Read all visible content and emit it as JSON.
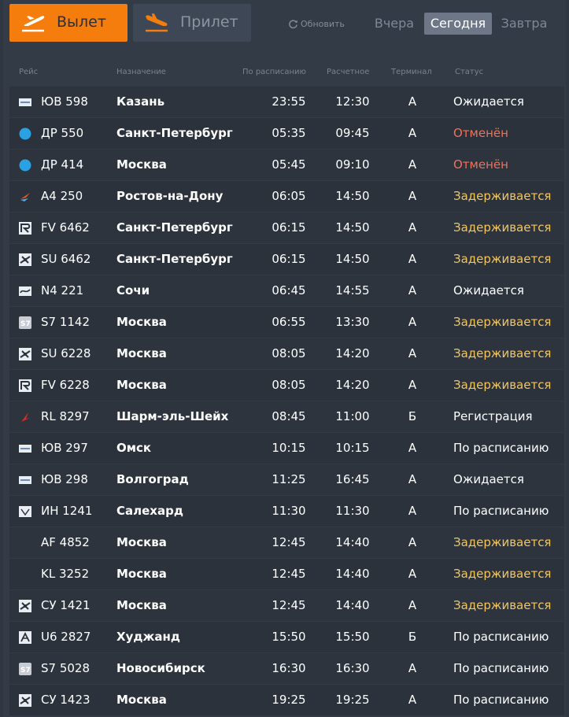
{
  "tabs": {
    "departures_label": "Вылет",
    "arrivals_label": "Прилет"
  },
  "refresh_label": "Обновить",
  "days": {
    "yesterday": "Вчера",
    "today": "Сегодня",
    "tomorrow": "Завтра",
    "selected": "today"
  },
  "columns": {
    "flight": "Рейс",
    "destination": "Назначение",
    "scheduled": "По расписанию",
    "estimated": "Расчетное",
    "terminal": "Терминал",
    "status": "Статус"
  },
  "colors": {
    "accent": "#f47d0d",
    "cancelled": "#f07158",
    "delayed": "#f5c65a"
  },
  "flights": [
    {
      "logo": "yuv-logo",
      "flight": "ЮВ 598",
      "destination": "Казань",
      "scheduled": "23:55",
      "estimated": "12:30",
      "terminal": "А",
      "status": "Ожидается",
      "state": "normal"
    },
    {
      "logo": "blue-dot-logo",
      "flight": "ДР 550",
      "destination": "Санкт-Петербург",
      "scheduled": "05:35",
      "estimated": "09:45",
      "terminal": "А",
      "status": "Отменён",
      "state": "cancelled"
    },
    {
      "logo": "blue-dot-logo",
      "flight": "ДР 414",
      "destination": "Москва",
      "scheduled": "05:45",
      "estimated": "09:10",
      "terminal": "А",
      "status": "Отменён",
      "state": "cancelled"
    },
    {
      "logo": "azimuth-logo",
      "flight": "А4 250",
      "destination": "Ростов-на-Дону",
      "scheduled": "06:05",
      "estimated": "14:50",
      "terminal": "А",
      "status": "Задерживается",
      "state": "delayed"
    },
    {
      "logo": "rossiya-logo",
      "flight": "FV 6462",
      "destination": "Санкт-Петербург",
      "scheduled": "06:15",
      "estimated": "14:50",
      "terminal": "А",
      "status": "Задерживается",
      "state": "delayed"
    },
    {
      "logo": "aeroflot-logo",
      "flight": "SU 6462",
      "destination": "Санкт-Петербург",
      "scheduled": "06:15",
      "estimated": "14:50",
      "terminal": "А",
      "status": "Задерживается",
      "state": "delayed"
    },
    {
      "logo": "nordwind-logo",
      "flight": "N4 221",
      "destination": "Сочи",
      "scheduled": "06:45",
      "estimated": "14:55",
      "terminal": "А",
      "status": "Ожидается",
      "state": "normal"
    },
    {
      "logo": "s7-logo",
      "flight": "S7 1142",
      "destination": "Москва",
      "scheduled": "06:55",
      "estimated": "13:30",
      "terminal": "А",
      "status": "Задерживается",
      "state": "delayed"
    },
    {
      "logo": "aeroflot-logo",
      "flight": "SU 6228",
      "destination": "Москва",
      "scheduled": "08:05",
      "estimated": "14:20",
      "terminal": "А",
      "status": "Задерживается",
      "state": "delayed"
    },
    {
      "logo": "rossiya-logo",
      "flight": "FV 6228",
      "destination": "Москва",
      "scheduled": "08:05",
      "estimated": "14:20",
      "terminal": "А",
      "status": "Задерживается",
      "state": "delayed"
    },
    {
      "logo": "royal-flight-logo",
      "flight": "RL 8297",
      "destination": "Шарм-эль-Шейх",
      "scheduled": "08:45",
      "estimated": "11:00",
      "terminal": "Б",
      "status": "Регистрация",
      "state": "normal"
    },
    {
      "logo": "yuv-logo",
      "flight": "ЮВ 297",
      "destination": "Омск",
      "scheduled": "10:15",
      "estimated": "10:15",
      "terminal": "А",
      "status": "По расписанию",
      "state": "normal"
    },
    {
      "logo": "yuv-logo",
      "flight": "ЮВ 298",
      "destination": "Волгоград",
      "scheduled": "11:25",
      "estimated": "16:45",
      "terminal": "А",
      "status": "Ожидается",
      "state": "normal"
    },
    {
      "logo": "izhavia-logo",
      "flight": "ИН 1241",
      "destination": "Салехард",
      "scheduled": "11:30",
      "estimated": "11:30",
      "terminal": "А",
      "status": "По расписанию",
      "state": "normal"
    },
    {
      "logo": "",
      "flight": "AF 4852",
      "destination": "Москва",
      "scheduled": "12:45",
      "estimated": "14:40",
      "terminal": "А",
      "status": "Задерживается",
      "state": "delayed"
    },
    {
      "logo": "",
      "flight": "KL 3252",
      "destination": "Москва",
      "scheduled": "12:45",
      "estimated": "14:40",
      "terminal": "А",
      "status": "Задерживается",
      "state": "delayed"
    },
    {
      "logo": "aeroflot-logo",
      "flight": "СУ 1421",
      "destination": "Москва",
      "scheduled": "12:45",
      "estimated": "14:40",
      "terminal": "А",
      "status": "Задерживается",
      "state": "delayed"
    },
    {
      "logo": "ural-logo",
      "flight": "U6 2827",
      "destination": "Худжанд",
      "scheduled": "15:50",
      "estimated": "15:50",
      "terminal": "Б",
      "status": "По расписанию",
      "state": "normal"
    },
    {
      "logo": "s7-logo",
      "flight": "S7 5028",
      "destination": "Новосибирск",
      "scheduled": "16:30",
      "estimated": "16:30",
      "terminal": "А",
      "status": "По расписанию",
      "state": "normal"
    },
    {
      "logo": "aeroflot-logo",
      "flight": "СУ 1423",
      "destination": "Москва",
      "scheduled": "19:25",
      "estimated": "19:25",
      "terminal": "А",
      "status": "По расписанию",
      "state": "normal"
    }
  ]
}
